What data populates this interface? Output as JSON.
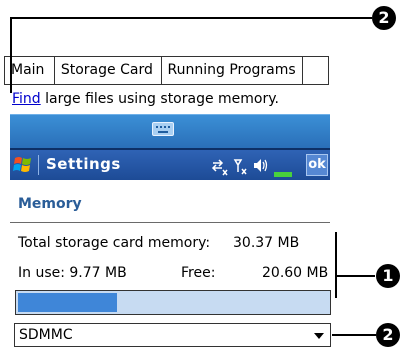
{
  "tabs": [
    {
      "label": "Main"
    },
    {
      "label": "Storage Card"
    },
    {
      "label": "Running Programs"
    },
    {
      "label": ""
    }
  ],
  "find_link": "Find",
  "find_rest": " large files using storage memory.",
  "title_bar": {
    "title": "Settings",
    "status": "⇄ₓ Ŷₓ ◄≤",
    "ok": "ok"
  },
  "memory": {
    "header": "Memory",
    "total_label": "Total storage card memory:",
    "total_value": "30.37 MB",
    "in_use_label": "In use:  9.77 MB",
    "free_label": "Free:",
    "free_value": "20.60 MB",
    "usage_fraction": 0.32
  },
  "select": {
    "value": "SDMMC"
  },
  "callouts": {
    "top": "2",
    "middle": "1",
    "bottom": "2"
  },
  "colors": {
    "title_bar": "#1d4b96",
    "progress": "#3f86d8",
    "header_text": "#2a5d98"
  }
}
